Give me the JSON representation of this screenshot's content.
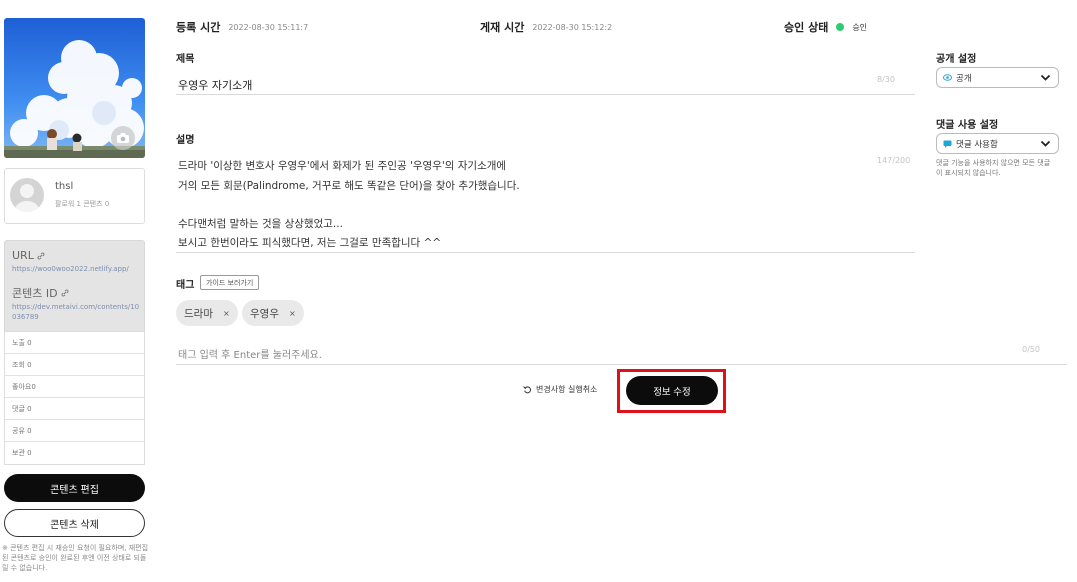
{
  "sidebar": {
    "username": "thsl",
    "user_stats": "팔로워 1 콘텐츠 0",
    "url_label": "URL",
    "url_value": "https://woo0woo2022.netlify.app/",
    "content_id_label": "콘텐츠 ID",
    "content_id_value": "https://dev.metaivi.com/contents/10036789",
    "stats": [
      "노출 0",
      "조회 0",
      "좋아요0",
      "댓글 0",
      "공유 0",
      "보관 0"
    ],
    "edit_button": "콘텐츠 편집",
    "delete_button": "콘텐츠 삭제",
    "note": "※ 콘텐츠 편집 시 재승인 요청이 필요하며, 재편집된 콘텐츠로 승인이 완료된 후엔 이전 상태로 되돌릴 수 없습니다."
  },
  "header": {
    "registered_label": "등록 시간",
    "registered_value": "2022-08-30 15:11:7",
    "published_label": "게재 시간",
    "published_value": "2022-08-30 15:12:2",
    "approval_label": "승인 상태",
    "approval_value": "승인",
    "approval_color": "#2ecc71"
  },
  "form": {
    "title_label": "제목",
    "title_value": "우영우 자기소개",
    "title_counter": "8/30",
    "desc_label": "설명",
    "desc_lines": [
      "드라마 '이상한 변호사 우영우'에서 화제가 된 주인공 '우영우'의 자기소개에",
      "거의 모든 회문(Palindrome, 거꾸로 해도 똑같은 단어)을 찾아 추가했습니다.",
      "",
      "수다맨처럼 말하는 것을 상상했었고...",
      "보시고 한번이라도 피식했다면, 저는 그걸로 만족합니다 ^^"
    ],
    "desc_counter": "147/200",
    "tag_label": "태그",
    "guide_button": "가이드 보러가기",
    "tags": [
      "드라마",
      "우영우"
    ],
    "tag_remove": "×",
    "tag_placeholder": "태그 입력 후 Enter를 눌러주세요.",
    "tag_counter": "0/50",
    "revert_button": "변경사항 실행취소",
    "submit_button": "정보 수정",
    "highlight_color": "#e0101a"
  },
  "settings": {
    "visibility_label": "공개 설정",
    "visibility_value": "공개",
    "comment_label": "댓글 사용 설정",
    "comment_value": "댓글 사용함",
    "comment_note": "댓글 기능을 사용하지 않으면 모든 댓글이 표시되지 않습니다."
  }
}
